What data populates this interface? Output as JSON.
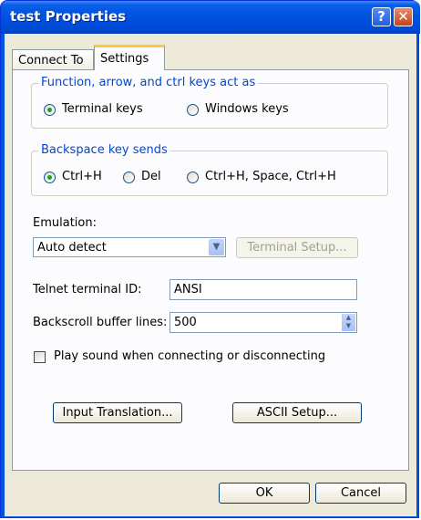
{
  "window": {
    "title": "test Properties",
    "help_glyph": "?",
    "close_glyph": "✕"
  },
  "tabs": [
    {
      "label": "Connect To"
    },
    {
      "label": "Settings"
    }
  ],
  "settings": {
    "keys_group": {
      "legend": "Function, arrow, and ctrl keys act as",
      "options": [
        {
          "label": "Terminal keys",
          "selected": true
        },
        {
          "label": "Windows keys",
          "selected": false
        }
      ]
    },
    "backspace_group": {
      "legend": "Backspace key sends",
      "options": [
        {
          "label": "Ctrl+H",
          "selected": true
        },
        {
          "label": "Del",
          "selected": false
        },
        {
          "label": "Ctrl+H, Space, Ctrl+H",
          "selected": false
        }
      ]
    },
    "emulation": {
      "label": "Emulation:",
      "value": "Auto detect",
      "setup_button": "Terminal Setup..."
    },
    "telnet_id": {
      "label": "Telnet terminal ID:",
      "value": "ANSI"
    },
    "backscroll": {
      "label": "Backscroll buffer lines:",
      "value": "500"
    },
    "play_sound": {
      "label": "Play sound when connecting or disconnecting",
      "checked": false
    },
    "input_translation_button": "Input Translation...",
    "ascii_setup_button": "ASCII Setup..."
  },
  "footer": {
    "ok": "OK",
    "cancel": "Cancel"
  },
  "icons": {
    "dropdown": "chevron-down-icon",
    "spin_up": "up-arrow-icon",
    "spin_down": "down-arrow-icon"
  }
}
